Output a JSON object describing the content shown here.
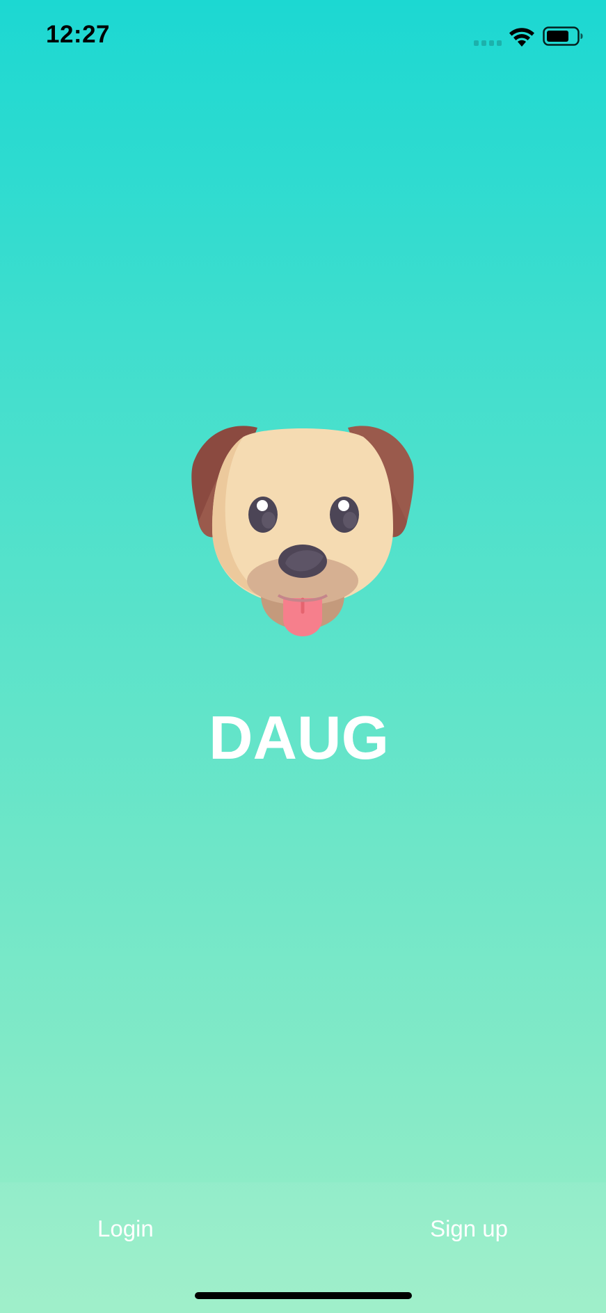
{
  "status_bar": {
    "time": "12:27",
    "icons": [
      "cellular-signal-icon",
      "wifi-icon",
      "battery-icon"
    ]
  },
  "logo": {
    "icon": "dog-face-icon"
  },
  "app": {
    "title": "DAUG"
  },
  "actions": {
    "login_label": "Login",
    "signup_label": "Sign up"
  },
  "colors": {
    "gradient_top": "#1cd8d2",
    "gradient_bottom": "#9aeec7",
    "text": "#ffffff"
  }
}
